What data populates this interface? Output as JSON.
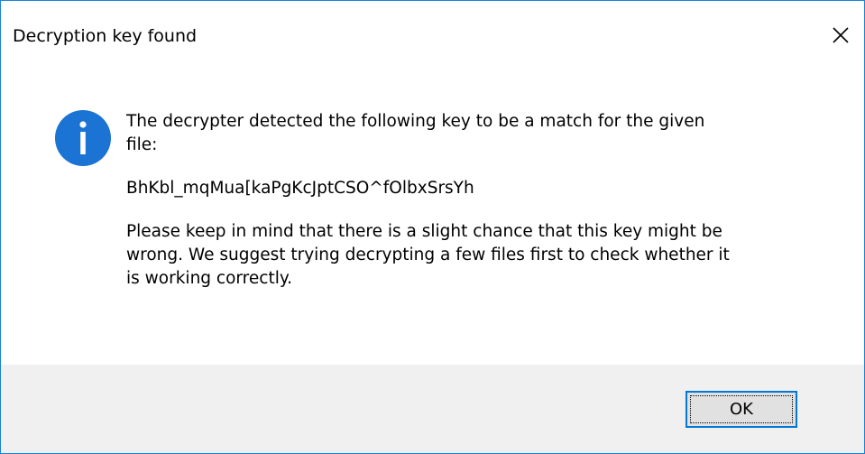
{
  "window": {
    "title": "Decryption key found",
    "close_icon": "close-icon"
  },
  "message": {
    "icon": "info-icon",
    "line1": "The decrypter detected the following key to be a match for the given",
    "line2": "file:",
    "key": "BhKbl_mqMua[kaPgKcJptCSO^fOlbxSrsYh",
    "note_line1": "Please keep in mind that there is a slight chance that this key might be",
    "note_line2": "wrong. We suggest trying decrypting a few files first to check whether it",
    "note_line3": "is working correctly."
  },
  "buttons": {
    "ok_label": "OK"
  },
  "colors": {
    "accent": "#1883d7",
    "info_icon": "#1b73d3",
    "footer_bg": "#f0f0f0",
    "button_bg": "#e1e1e1",
    "button_border": "#0078d7"
  }
}
